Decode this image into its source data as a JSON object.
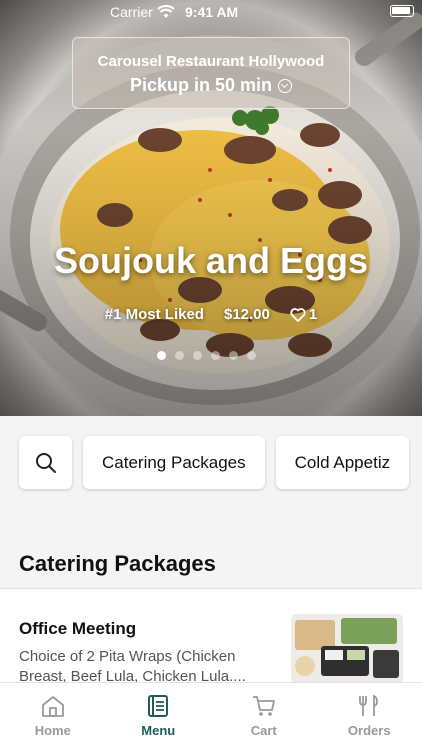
{
  "status_bar": {
    "carrier": "Carrier",
    "time": "9:41 AM"
  },
  "pickup": {
    "restaurant": "Carousel Restaurant Hollywood",
    "time_label": "Pickup in 50 min"
  },
  "hero": {
    "title": "Soujouk and Eggs",
    "badge": "#1 Most Liked",
    "price": "$12.00",
    "likes": "1",
    "carousel_pages": 6,
    "carousel_active_index": 0
  },
  "categories": {
    "search_icon": "search-icon",
    "chips": [
      "Catering Packages",
      "Cold Appetiz"
    ]
  },
  "section": {
    "title": "Catering Packages"
  },
  "menu_items": [
    {
      "name": "Office Meeting",
      "description": "Choice of 2 Pita Wraps (Chicken Breast, Beef Lula, Chicken Lula...."
    }
  ],
  "tabs": [
    {
      "label": "Home",
      "icon": "home-icon",
      "active": false
    },
    {
      "label": "Menu",
      "icon": "menu-book-icon",
      "active": true
    },
    {
      "label": "Cart",
      "icon": "cart-icon",
      "active": false
    },
    {
      "label": "Orders",
      "icon": "fork-knife-icon",
      "active": false
    }
  ],
  "colors": {
    "accent": "#1f5c57",
    "inactive": "#9a9a9a",
    "background": "#f4f4f4"
  }
}
